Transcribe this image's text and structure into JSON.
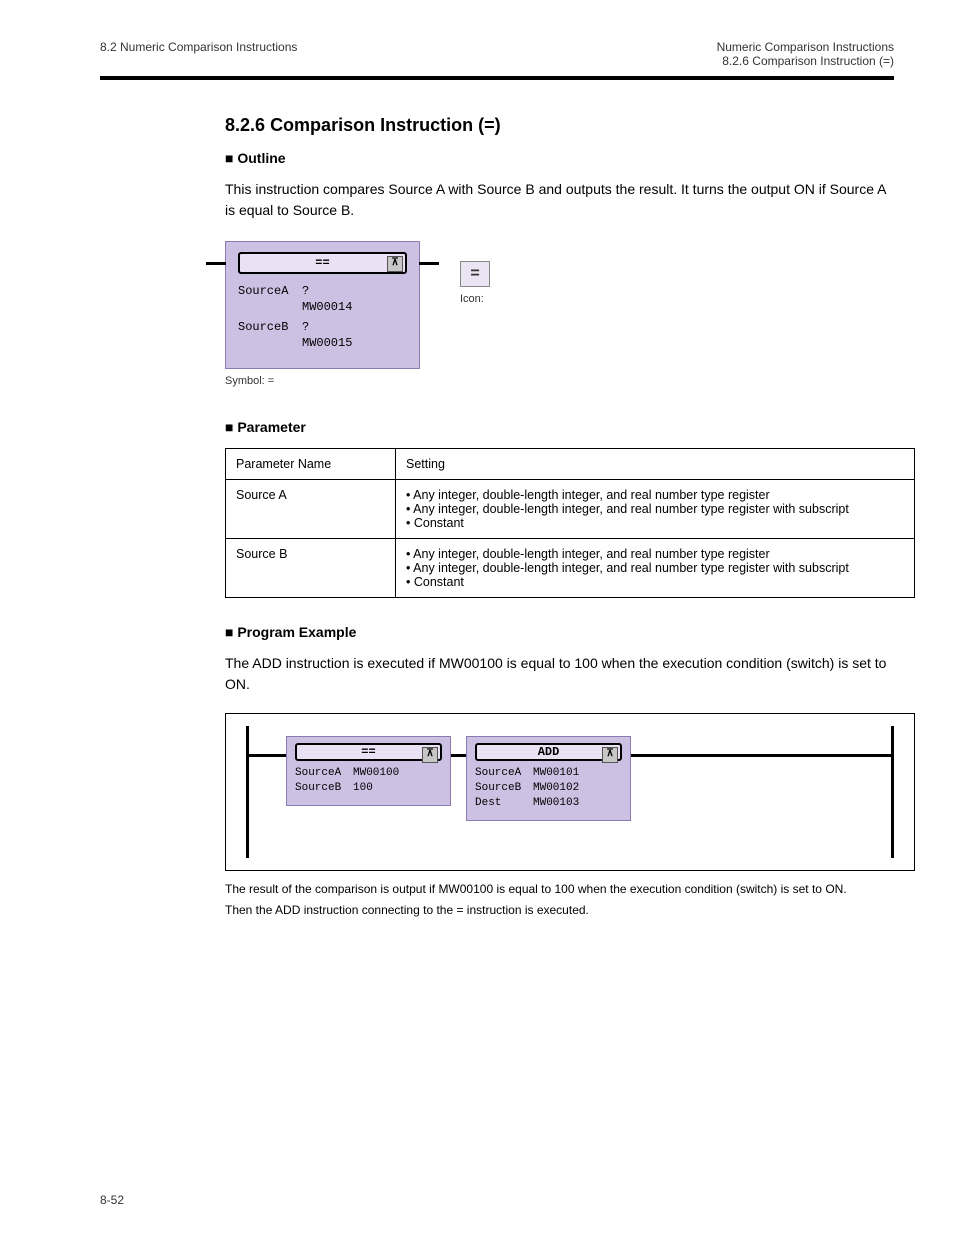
{
  "header": {
    "left": "8.2 Numeric Comparison Instructions",
    "right_line1": "Numeric Comparison Instructions",
    "right_line2": "8.2.6 Comparison Instruction (=)"
  },
  "section": {
    "number": "8.2.6",
    "title": "Comparison Instruction (=)"
  },
  "outline_label": "■ Outline",
  "outline_text": "This instruction compares Source A with Source B and outputs the result. It turns the output ON if Source A is equal to Source B.",
  "figure1": {
    "op": "==",
    "expand_glyph": "⊼",
    "rows": [
      {
        "label": "SourceA",
        "q": "?",
        "value": "MW00014"
      },
      {
        "label": "SourceB",
        "q": "?",
        "value": "MW00015"
      }
    ],
    "symbol_caption": "Symbol: =",
    "icon_glyph": "=",
    "icon_caption": "Icon:"
  },
  "params_label": "■ Parameter",
  "table": {
    "headers": [
      "Parameter Name",
      "Setting"
    ],
    "rows": [
      {
        "name": "Source A",
        "lines": [
          "• Any integer, double-length integer, and real number type register",
          "• Any integer, double-length integer, and real number type register with subscript",
          "• Constant"
        ]
      },
      {
        "name": "Source B",
        "lines": [
          "• Any integer, double-length integer, and real number type register",
          "• Any integer, double-length integer, and real number type register with subscript",
          "• Constant"
        ]
      }
    ]
  },
  "example_label": "■ Program Example",
  "example_intro": "The ADD instruction is executed if MW00100 is equal to 100 when the execution condition (switch) is set to ON.",
  "rung": {
    "block1": {
      "op": "==",
      "rows": [
        {
          "label": "SourceA",
          "value": "MW00100"
        },
        {
          "label": "SourceB",
          "value": "100"
        }
      ]
    },
    "block2": {
      "op": "ADD",
      "rows": [
        {
          "label": "SourceA",
          "value": "MW00101"
        },
        {
          "label": "SourceB",
          "value": "MW00102"
        },
        {
          "label": "Dest",
          "value": "MW00103"
        }
      ]
    }
  },
  "caption_lines": [
    "The result of the comparison is output if MW00100 is equal to 100 when the execution condition (switch) is set to ON.",
    "Then the ADD instruction connecting to the = instruction is executed."
  ],
  "footer": "8-52"
}
